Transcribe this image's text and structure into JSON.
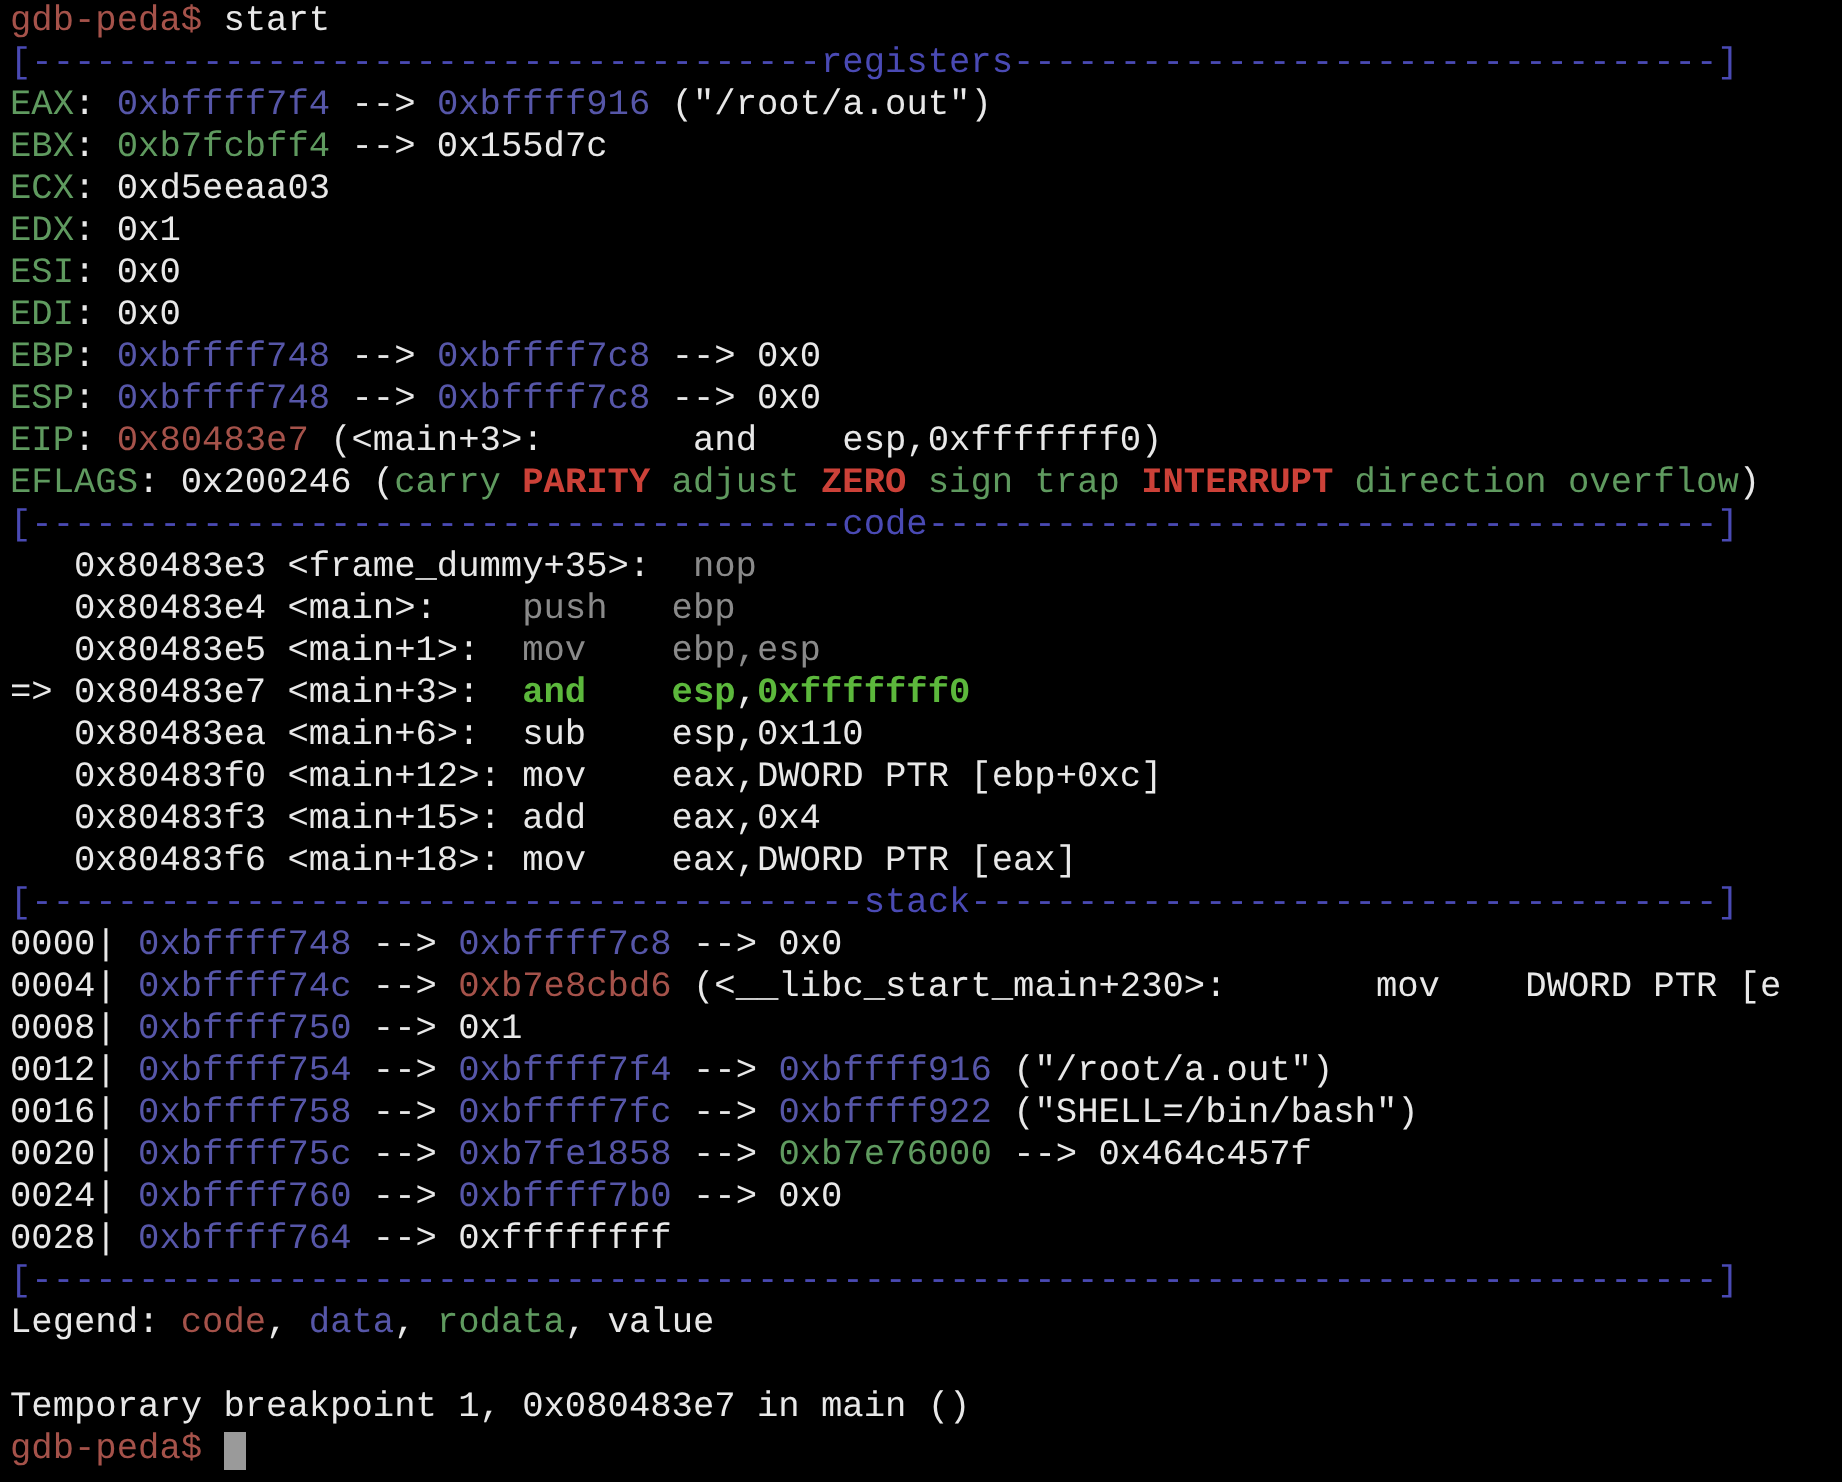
{
  "terminal": {
    "cursor_visible": true,
    "lines": [
      {
        "kind": "text",
        "segments": [
          {
            "kind": "prompt",
            "text": "gdb-peda$"
          },
          {
            "kind": "plain",
            "text": " start"
          }
        ]
      },
      {
        "kind": "text",
        "segments": [
          {
            "kind": "rule",
            "text": "[-------------------------------------registers---------------------------------]"
          }
        ]
      },
      {
        "kind": "text",
        "segments": [
          {
            "kind": "label",
            "text": "EAX"
          },
          {
            "kind": "plain",
            "text": ": "
          },
          {
            "kind": "data",
            "text": "0xbffff7f4"
          },
          {
            "kind": "plain",
            "text": " --> "
          },
          {
            "kind": "data",
            "text": "0xbffff916"
          },
          {
            "kind": "plain",
            "text": " (\"/root/a.out\")"
          }
        ]
      },
      {
        "kind": "text",
        "segments": [
          {
            "kind": "label",
            "text": "EBX"
          },
          {
            "kind": "plain",
            "text": ": "
          },
          {
            "kind": "rodata",
            "text": "0xb7fcbff4"
          },
          {
            "kind": "plain",
            "text": " --> 0x155d7c"
          }
        ]
      },
      {
        "kind": "text",
        "segments": [
          {
            "kind": "label",
            "text": "ECX"
          },
          {
            "kind": "plain",
            "text": ": 0xd5eeaa03"
          }
        ]
      },
      {
        "kind": "text",
        "segments": [
          {
            "kind": "label",
            "text": "EDX"
          },
          {
            "kind": "plain",
            "text": ": 0x1"
          }
        ]
      },
      {
        "kind": "text",
        "segments": [
          {
            "kind": "label",
            "text": "ESI"
          },
          {
            "kind": "plain",
            "text": ": 0x0"
          }
        ]
      },
      {
        "kind": "text",
        "segments": [
          {
            "kind": "label",
            "text": "EDI"
          },
          {
            "kind": "plain",
            "text": ": 0x0"
          }
        ]
      },
      {
        "kind": "text",
        "segments": [
          {
            "kind": "label",
            "text": "EBP"
          },
          {
            "kind": "plain",
            "text": ": "
          },
          {
            "kind": "data",
            "text": "0xbffff748"
          },
          {
            "kind": "plain",
            "text": " --> "
          },
          {
            "kind": "data",
            "text": "0xbffff7c8"
          },
          {
            "kind": "plain",
            "text": " --> 0x0"
          }
        ]
      },
      {
        "kind": "text",
        "segments": [
          {
            "kind": "label",
            "text": "ESP"
          },
          {
            "kind": "plain",
            "text": ": "
          },
          {
            "kind": "data",
            "text": "0xbffff748"
          },
          {
            "kind": "plain",
            "text": " --> "
          },
          {
            "kind": "data",
            "text": "0xbffff7c8"
          },
          {
            "kind": "plain",
            "text": " --> 0x0"
          }
        ]
      },
      {
        "kind": "text",
        "segments": [
          {
            "kind": "label",
            "text": "EIP"
          },
          {
            "kind": "plain",
            "text": ": "
          },
          {
            "kind": "code",
            "text": "0x80483e7"
          },
          {
            "kind": "plain",
            "text": " (<main+3>:       and    esp,0xfffffff0)"
          }
        ]
      },
      {
        "kind": "text",
        "segments": [
          {
            "kind": "label",
            "text": "EFLAGS"
          },
          {
            "kind": "plain",
            "text": ": 0x200246 ("
          },
          {
            "kind": "rodata",
            "text": "carry "
          },
          {
            "kind": "flag",
            "text": "PARITY"
          },
          {
            "kind": "rodata",
            "text": " adjust "
          },
          {
            "kind": "flag",
            "text": "ZERO"
          },
          {
            "kind": "rodata",
            "text": " sign trap "
          },
          {
            "kind": "flag",
            "text": "INTERRUPT"
          },
          {
            "kind": "rodata",
            "text": " direction overflow"
          },
          {
            "kind": "plain",
            "text": ")"
          }
        ]
      },
      {
        "kind": "text",
        "segments": [
          {
            "kind": "rule",
            "text": "[--------------------------------------code-------------------------------------]"
          }
        ]
      },
      {
        "kind": "text",
        "segments": [
          {
            "kind": "plain",
            "text": "   0x80483e3 <frame_dummy+35>:"
          },
          {
            "kind": "dim",
            "text": "  nop"
          }
        ]
      },
      {
        "kind": "text",
        "segments": [
          {
            "kind": "plain",
            "text": "   0x80483e4 <main>:    "
          },
          {
            "kind": "dim",
            "text": "push   ebp"
          }
        ]
      },
      {
        "kind": "text",
        "segments": [
          {
            "kind": "plain",
            "text": "   0x80483e5 <main+1>:  "
          },
          {
            "kind": "dim",
            "text": "mov    ebp,esp"
          }
        ]
      },
      {
        "kind": "text",
        "segments": [
          {
            "kind": "plain",
            "text": "=> 0x80483e7 <main+3>:  "
          },
          {
            "kind": "current",
            "text": "and    esp"
          },
          {
            "kind": "plain",
            "text": ","
          },
          {
            "kind": "current",
            "text": "0xfffffff0"
          }
        ]
      },
      {
        "kind": "text",
        "segments": [
          {
            "kind": "plain",
            "text": "   0x80483ea <main+6>:  sub    esp,0x110"
          }
        ]
      },
      {
        "kind": "text",
        "segments": [
          {
            "kind": "plain",
            "text": "   0x80483f0 <main+12>: mov    eax,DWORD PTR [ebp+0xc]"
          }
        ]
      },
      {
        "kind": "text",
        "segments": [
          {
            "kind": "plain",
            "text": "   0x80483f3 <main+15>: add    eax,0x4"
          }
        ]
      },
      {
        "kind": "text",
        "segments": [
          {
            "kind": "plain",
            "text": "   0x80483f6 <main+18>: mov    eax,DWORD PTR [eax]"
          }
        ]
      },
      {
        "kind": "text",
        "segments": [
          {
            "kind": "rule",
            "text": "[---------------------------------------stack-----------------------------------]"
          }
        ]
      },
      {
        "kind": "text",
        "segments": [
          {
            "kind": "plain",
            "text": "0000| "
          },
          {
            "kind": "data",
            "text": "0xbffff748"
          },
          {
            "kind": "plain",
            "text": " --> "
          },
          {
            "kind": "data",
            "text": "0xbffff7c8"
          },
          {
            "kind": "plain",
            "text": " --> 0x0"
          }
        ]
      },
      {
        "kind": "text",
        "segments": [
          {
            "kind": "plain",
            "text": "0004| "
          },
          {
            "kind": "data",
            "text": "0xbffff74c"
          },
          {
            "kind": "plain",
            "text": " --> "
          },
          {
            "kind": "code",
            "text": "0xb7e8cbd6"
          },
          {
            "kind": "plain",
            "text": " (<__libc_start_main+230>:       mov    DWORD PTR [e"
          }
        ]
      },
      {
        "kind": "text",
        "segments": [
          {
            "kind": "plain",
            "text": "0008| "
          },
          {
            "kind": "data",
            "text": "0xbffff750"
          },
          {
            "kind": "plain",
            "text": " --> 0x1"
          }
        ]
      },
      {
        "kind": "text",
        "segments": [
          {
            "kind": "plain",
            "text": "0012| "
          },
          {
            "kind": "data",
            "text": "0xbffff754"
          },
          {
            "kind": "plain",
            "text": " --> "
          },
          {
            "kind": "data",
            "text": "0xbffff7f4"
          },
          {
            "kind": "plain",
            "text": " --> "
          },
          {
            "kind": "data",
            "text": "0xbffff916"
          },
          {
            "kind": "plain",
            "text": " (\"/root/a.out\")"
          }
        ]
      },
      {
        "kind": "text",
        "segments": [
          {
            "kind": "plain",
            "text": "0016| "
          },
          {
            "kind": "data",
            "text": "0xbffff758"
          },
          {
            "kind": "plain",
            "text": " --> "
          },
          {
            "kind": "data",
            "text": "0xbffff7fc"
          },
          {
            "kind": "plain",
            "text": " --> "
          },
          {
            "kind": "data",
            "text": "0xbffff922"
          },
          {
            "kind": "plain",
            "text": " (\"SHELL=/bin/bash\")"
          }
        ]
      },
      {
        "kind": "text",
        "segments": [
          {
            "kind": "plain",
            "text": "0020| "
          },
          {
            "kind": "data",
            "text": "0xbffff75c"
          },
          {
            "kind": "plain",
            "text": " --> "
          },
          {
            "kind": "data",
            "text": "0xb7fe1858"
          },
          {
            "kind": "plain",
            "text": " --> "
          },
          {
            "kind": "rodata",
            "text": "0xb7e76000"
          },
          {
            "kind": "plain",
            "text": " --> 0x464c457f"
          }
        ]
      },
      {
        "kind": "text",
        "segments": [
          {
            "kind": "plain",
            "text": "0024| "
          },
          {
            "kind": "data",
            "text": "0xbffff760"
          },
          {
            "kind": "plain",
            "text": " --> "
          },
          {
            "kind": "data",
            "text": "0xbffff7b0"
          },
          {
            "kind": "plain",
            "text": " --> 0x0"
          }
        ]
      },
      {
        "kind": "text",
        "segments": [
          {
            "kind": "plain",
            "text": "0028| "
          },
          {
            "kind": "data",
            "text": "0xbffff764"
          },
          {
            "kind": "plain",
            "text": " --> 0xffffffff"
          }
        ]
      },
      {
        "kind": "text",
        "segments": [
          {
            "kind": "rule",
            "text": "[-------------------------------------------------------------------------------]"
          }
        ]
      },
      {
        "kind": "text",
        "segments": [
          {
            "kind": "plain",
            "text": "Legend: "
          },
          {
            "kind": "code",
            "text": "code"
          },
          {
            "kind": "plain",
            "text": ", "
          },
          {
            "kind": "data",
            "text": "data"
          },
          {
            "kind": "plain",
            "text": ", "
          },
          {
            "kind": "rodata",
            "text": "rodata"
          },
          {
            "kind": "plain",
            "text": ", value"
          }
        ]
      },
      {
        "kind": "blank"
      },
      {
        "kind": "text",
        "segments": [
          {
            "kind": "plain",
            "text": "Temporary breakpoint 1, 0x080483e7 in main ()"
          }
        ]
      },
      {
        "kind": "prompt",
        "segments": [
          {
            "kind": "prompt",
            "text": "gdb-peda$ "
          }
        ]
      }
    ]
  }
}
